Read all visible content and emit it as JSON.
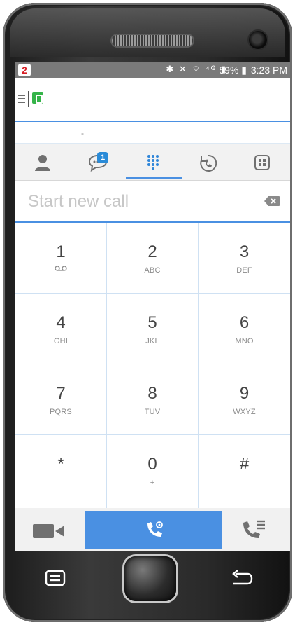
{
  "status_bar": {
    "app_icon": "2",
    "icons": "✱ ✕ ⌔ ⁴ᴳ ▮",
    "battery": "59% ▮",
    "time": "3:23 PM"
  },
  "tabs": [
    {
      "name": "contacts",
      "icon": "person-icon"
    },
    {
      "name": "messages",
      "icon": "chat-icon",
      "badge": "1"
    },
    {
      "name": "dialpad",
      "icon": "dialpad-icon",
      "selected": true
    },
    {
      "name": "history",
      "icon": "history-icon"
    },
    {
      "name": "directory",
      "icon": "building-icon"
    }
  ],
  "dial": {
    "placeholder": "Start new call"
  },
  "keypad": [
    {
      "num": "1",
      "sub": ""
    },
    {
      "num": "2",
      "sub": "ABC"
    },
    {
      "num": "3",
      "sub": "DEF"
    },
    {
      "num": "4",
      "sub": "GHI"
    },
    {
      "num": "5",
      "sub": "JKL"
    },
    {
      "num": "6",
      "sub": "MNO"
    },
    {
      "num": "7",
      "sub": "PQRS"
    },
    {
      "num": "8",
      "sub": "TUV"
    },
    {
      "num": "9",
      "sub": "WXYZ"
    },
    {
      "num": "*",
      "sub": ""
    },
    {
      "num": "0",
      "sub": "+"
    },
    {
      "num": "#",
      "sub": ""
    }
  ],
  "colors": {
    "accent": "#4a90e2",
    "presence": "#35b44a",
    "badge": "#2a8bd8"
  }
}
